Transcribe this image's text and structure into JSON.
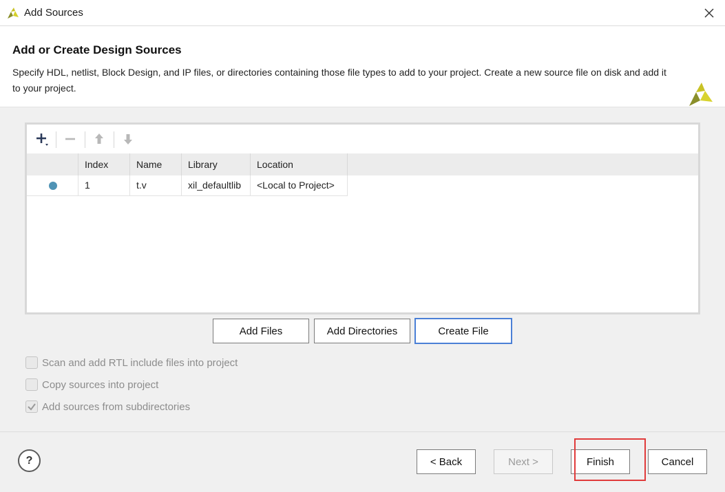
{
  "window": {
    "title": "Add Sources"
  },
  "header": {
    "heading": "Add or Create Design Sources",
    "description": "Specify HDL, netlist, Block Design, and IP files, or directories containing those file types to add to your project. Create a new source file on disk and add it to your project."
  },
  "toolbar": {
    "add_icon": "plus-icon",
    "remove_icon": "minus-icon",
    "up_icon": "arrow-up-icon",
    "down_icon": "arrow-down-icon"
  },
  "table": {
    "columns": [
      "",
      "Index",
      "Name",
      "Library",
      "Location"
    ],
    "rows": [
      {
        "status_color": "#4f93b5",
        "index": "1",
        "name": "t.v",
        "library": "xil_defaultlib",
        "location": "<Local to Project>"
      }
    ]
  },
  "actions": {
    "add_files": "Add Files",
    "add_directories": "Add Directories",
    "create_file": "Create File"
  },
  "options": [
    {
      "label": "Scan and add RTL include files into project",
      "checked": false,
      "enabled": false
    },
    {
      "label": "Copy sources into project",
      "checked": false,
      "enabled": false
    },
    {
      "label": "Add sources from subdirectories",
      "checked": true,
      "enabled": false
    }
  ],
  "footer": {
    "help": "?",
    "back": "< Back",
    "next": "Next >",
    "finish": "Finish",
    "cancel": "Cancel"
  },
  "colors": {
    "accent": "#4a7fd6",
    "highlight": "#e03a3a",
    "status_dot": "#4f93b5"
  }
}
